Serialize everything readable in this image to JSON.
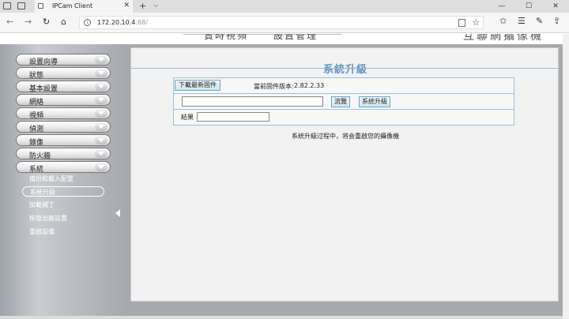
{
  "browser": {
    "tab_title": "IPCam Client",
    "tab_close": "✕",
    "new_tab": "+",
    "tab_dropdown": "⌵",
    "address_host": "172.20.10.4",
    "address_path": ":88/",
    "window_controls": [
      "—",
      "☐",
      "✕"
    ]
  },
  "banner": {
    "item1": "實時視頻",
    "item2": "設置管理",
    "brand": "互聯網攝像機"
  },
  "sidebar": {
    "menu": [
      {
        "label": "設置向導"
      },
      {
        "label": "狀態"
      },
      {
        "label": "基本設置"
      },
      {
        "label": "網絡"
      },
      {
        "label": "視頻"
      },
      {
        "label": "偵測"
      },
      {
        "label": "錄像"
      },
      {
        "label": "防火牆"
      },
      {
        "label": "系統"
      }
    ],
    "submenu": [
      {
        "label": "備份和載入配置"
      },
      {
        "label": "系統升級"
      },
      {
        "label": "加載補丁"
      },
      {
        "label": "恢復出廠設置"
      },
      {
        "label": "重啟設備"
      }
    ]
  },
  "main": {
    "title": "系統升級",
    "download_button": "下載最新固件",
    "current_version_label": "當前固件版本:",
    "current_version": "2.82.2.33",
    "file_path_value": "",
    "browse_button": "流覽",
    "upgrade_button": "系統升級",
    "result_label": "結果",
    "result_value": "",
    "note": "系統升級过程中，将会重啟您的攝像機"
  },
  "colors": {
    "accent": "#5f93c4",
    "sidebar_bg": "#b4b8bd",
    "panel_bg": "#f2f2f2"
  }
}
